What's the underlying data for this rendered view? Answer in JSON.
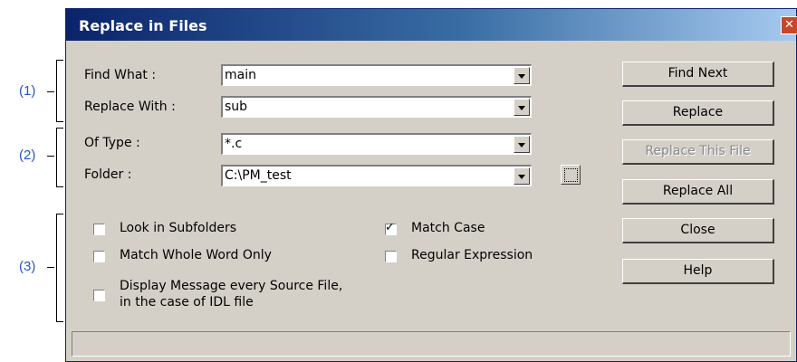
{
  "callouts": [
    "(1)",
    "(2)",
    "(3)"
  ],
  "window": {
    "title": "Replace in Files",
    "close_glyph": "✕"
  },
  "fields": {
    "find_what": {
      "label": "Find What :",
      "value": "main"
    },
    "replace_with": {
      "label": "Replace With :",
      "value": "sub"
    },
    "of_type": {
      "label": "Of Type :",
      "value": "*.c"
    },
    "folder": {
      "label": "Folder :",
      "value": "C:\\PM_test"
    }
  },
  "checkboxes": {
    "look_in_subfolders": {
      "label": "Look in Subfolders",
      "checked": false
    },
    "match_whole_word": {
      "label": "Match Whole Word Only",
      "checked": false
    },
    "match_case": {
      "label": "Match Case",
      "checked": true
    },
    "regular_expression": {
      "label": "Regular Expression",
      "checked": false
    },
    "display_message": {
      "label_line1": "Display Message every Source File,",
      "label_line2": "in the case of IDL file",
      "checked": false
    }
  },
  "buttons": {
    "find_next": "Find Next",
    "replace": "Replace",
    "replace_this_file": "Replace This File",
    "replace_all": "Replace All",
    "close": "Close",
    "help": "Help"
  },
  "check_glyph": "✓",
  "colors": {
    "title_bar": "#0a246a",
    "callout": "#2455c8",
    "dialog": "#d4d0c8"
  }
}
